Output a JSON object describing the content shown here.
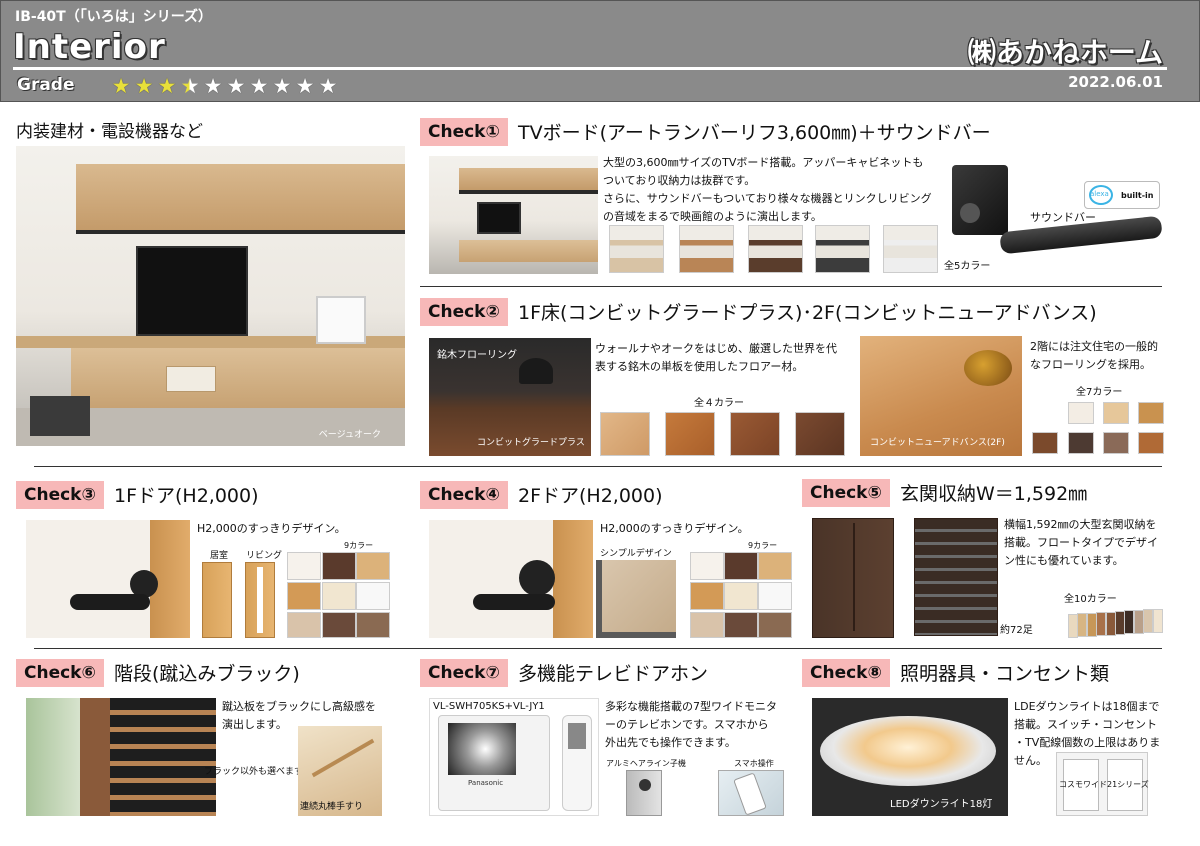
{
  "header": {
    "model": "IB-40T（「いろは」シリーズ）",
    "title": "Interior",
    "grade_label": "Grade",
    "grade_rating": 3.5,
    "grade_max": 10,
    "company": "㈱あかねホーム",
    "date": "2022.06.01"
  },
  "colors": {
    "badge": "#f7b8b8",
    "header_bg": "#8a8a8a",
    "star": "#e8e03a"
  },
  "left": {
    "heading": "内装建材・電設機器など",
    "photo_caption": "ベージュオーク"
  },
  "check1": {
    "badge": "Check①",
    "title": "TVボード(アートランバーリフ3,600㎜)＋サウンドバー",
    "desc": [
      "大型の3,600㎜サイズのTVボード搭載。アッパーキャビネットも",
      "ついており収納力は抜群です。",
      "さらに、サウンドバーもついており様々な機器とリンクしリビング",
      "の音域をまるで映画館のように演出します。"
    ],
    "colors_label": "全5カラー",
    "soundbar_label": "サウンドバー",
    "alexa": "alexa",
    "builtin": "built-in"
  },
  "check2": {
    "badge": "Check②",
    "title": "1F床(コンビットグラードプラス)･2F(コンビットニューアドバンス)",
    "img1_top": "銘木フローリング",
    "img1_bottom": "コンビットグラードプラス",
    "desc1": [
      "ウォールナやオークをはじめ、厳選した世界を代",
      "表する銘木の単板を使用したフロアー材。"
    ],
    "colors1_label": "全４カラー",
    "img2_bottom": "コンビットニューアドバンス(2F)",
    "desc2": [
      "2階には注文住宅の一般的",
      "なフローリングを採用。"
    ],
    "colors2_label": "全7カラー"
  },
  "check3": {
    "badge": "Check③",
    "title": "1Fドア(H2,000)",
    "desc": "H2,000のすっきりデザイン。",
    "label_a": "居室",
    "label_b": "リビング",
    "colors_label": "9カラー"
  },
  "check4": {
    "badge": "Check④",
    "title": "2Fドア(H2,000)",
    "desc": "H2,000のすっきりデザイン。",
    "simple_label": "シンプルデザイン",
    "colors_label": "9カラー"
  },
  "check5": {
    "badge": "Check⑤",
    "title": "玄関収納W＝1,592㎜",
    "desc": [
      "横幅1,592㎜の大型玄関収納を",
      "搭載。フロートタイプでデザイ",
      "ン性にも優れています。"
    ],
    "colors_label": "全10カラー",
    "shoes_label": "約72足"
  },
  "check6": {
    "badge": "Check⑥",
    "title": "階段(蹴込みブラック)",
    "desc": [
      "蹴込板をブラックにし高級感を",
      "演出します。"
    ],
    "other_label": "ブラック以外も選べます",
    "handrail_label": "連続丸棒手すり"
  },
  "check7": {
    "badge": "Check⑦",
    "title": "多機能テレビドアホン",
    "model": "VL-SWH705KS+VL-JY1",
    "desc": [
      "多彩な機能搭載の7型ワイドモニタ",
      "ーのテレビホンです。スマホから",
      "外出先でも操作できます。"
    ],
    "door_unit_label": "アルミヘアライン子機",
    "phone_label": "スマホ操作",
    "brand": "Panasonic"
  },
  "check8": {
    "badge": "Check⑧",
    "title": "照明器具・コンセント類",
    "desc": [
      "LDEダウンライトは18個まで",
      "搭載。スイッチ・コンセント",
      "・TV配線個数の上限はありま",
      "せん。"
    ],
    "light_label": "LEDダウンライト18灯",
    "switch_label": "コスモワイド21シリーズ"
  }
}
